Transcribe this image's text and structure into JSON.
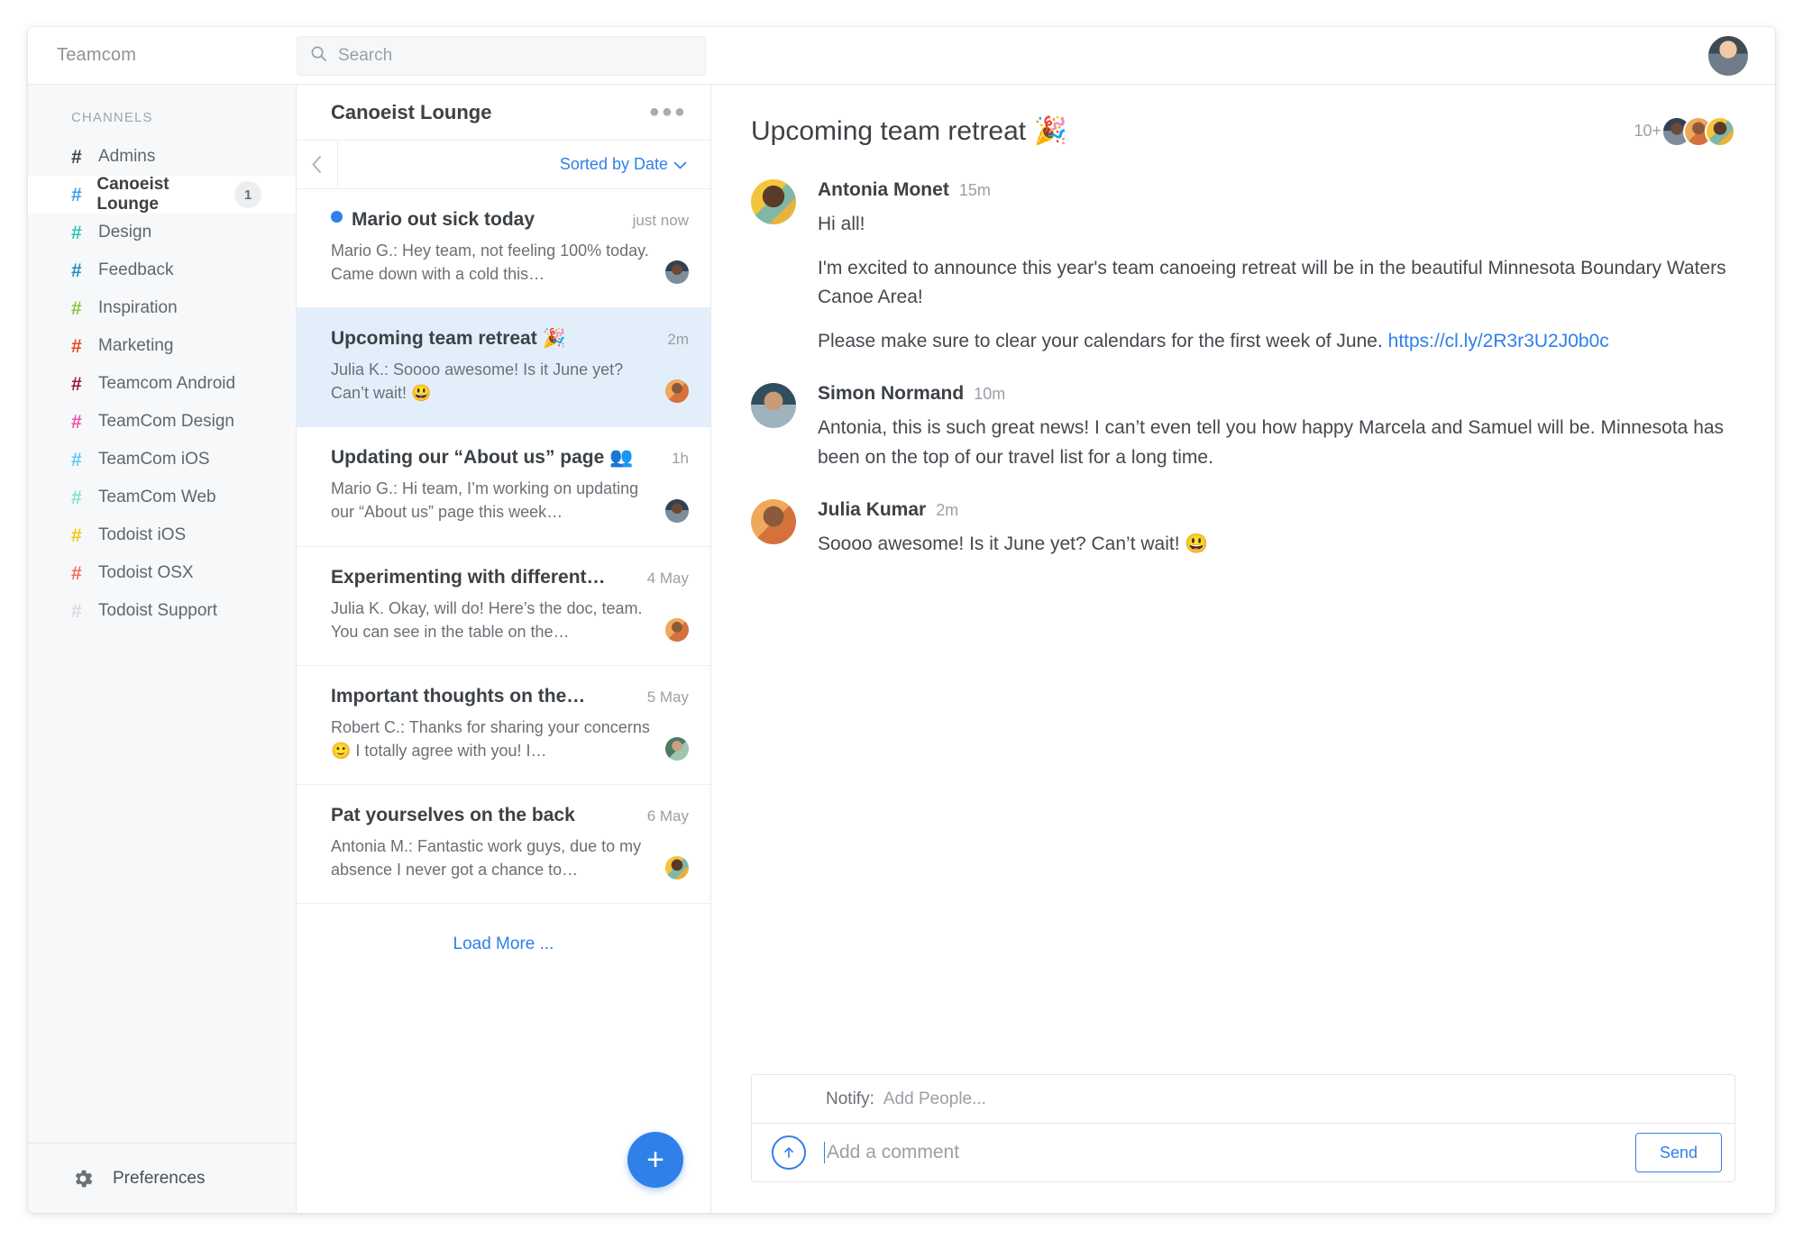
{
  "topbar": {
    "brand": "Teamcom",
    "search_placeholder": "Search",
    "search_value": ""
  },
  "sidebar": {
    "section_title": "CHANNELS",
    "channels": [
      {
        "label": "Admins",
        "color": "#3c4146",
        "badge": "",
        "active": false
      },
      {
        "label": "Canoeist Lounge",
        "color": "#3ba3f0",
        "badge": "1",
        "active": true
      },
      {
        "label": "Design",
        "color": "#2ec4b6",
        "badge": "",
        "active": false
      },
      {
        "label": "Feedback",
        "color": "#1f8fbf",
        "badge": "",
        "active": false
      },
      {
        "label": "Inspiration",
        "color": "#8cc63f",
        "badge": "",
        "active": false
      },
      {
        "label": "Marketing",
        "color": "#e8491f",
        "badge": "",
        "active": false
      },
      {
        "label": "Teamcom Android",
        "color": "#9c1439",
        "badge": "",
        "active": false
      },
      {
        "label": "TeamCom Design",
        "color": "#ef52a8",
        "badge": "",
        "active": false
      },
      {
        "label": "TeamCom iOS",
        "color": "#5ecbf7",
        "badge": "",
        "active": false
      },
      {
        "label": "TeamCom Web",
        "color": "#7fe3c8",
        "badge": "",
        "active": false
      },
      {
        "label": "Todoist iOS",
        "color": "#f5c518",
        "badge": "",
        "active": false
      },
      {
        "label": "Todoist OSX",
        "color": "#f07057",
        "badge": "",
        "active": false
      },
      {
        "label": "Todoist Support",
        "color": "#d8dade",
        "badge": "",
        "active": false
      }
    ],
    "preferences_label": "Preferences"
  },
  "threads_panel": {
    "title": "Canoeist Lounge",
    "sort_label": "Sorted by Date",
    "load_more_label": "Load More ...",
    "new_thread_label": "+",
    "items": [
      {
        "title": "Mario out sick today",
        "time": "just now",
        "preview": "Mario G.: Hey team, not feeling 100% today. Came down with a cold this…",
        "unread": true,
        "selected": false,
        "avatar": "mario"
      },
      {
        "title": "Upcoming team retreat 🎉",
        "time": "2m",
        "preview": "Julia K.: Soooo awesome! Is it June yet? Can’t wait! 😃",
        "unread": false,
        "selected": true,
        "avatar": "julia"
      },
      {
        "title": "Updating our “About us” page 👥",
        "time": "1h",
        "preview": "Mario G.: Hi team, I’m working on updating our “About us” page this week…",
        "unread": false,
        "selected": false,
        "avatar": "mario"
      },
      {
        "title": "Experimenting with different…",
        "time": "4 May",
        "preview": "Julia K. Okay, will do! Here’s the doc, team. You can see in the table on the…",
        "unread": false,
        "selected": false,
        "avatar": "julia"
      },
      {
        "title": "Important thoughts on the…",
        "time": "5 May",
        "preview": "Robert C.: Thanks for sharing your concerns 🙂 I totally agree with you! I…",
        "unread": false,
        "selected": false,
        "avatar": "robert"
      },
      {
        "title": "Pat yourselves on the back",
        "time": "6 May",
        "preview": "Antonia M.: Fantastic work guys, due to my absence I never got a chance to…",
        "unread": false,
        "selected": false,
        "avatar": "antonia"
      }
    ]
  },
  "conversation": {
    "title": "Upcoming team retreat 🎉",
    "participants_count": "10+",
    "messages": [
      {
        "name": "Antonia Monet",
        "time": "15m",
        "avatar": "antonia",
        "paragraphs": [
          "Hi all!",
          "I'm excited to announce this year's team canoeing retreat will be in the beautiful Minnesota Boundary Waters Canoe Area!"
        ],
        "trailing_text": "Please make sure to clear your calendars for the first week of June. ",
        "link": "https://cl.ly/2R3r3U2J0b0c"
      },
      {
        "name": "Simon Normand",
        "time": "10m",
        "avatar": "simon",
        "paragraphs": [
          "Antonia, this is such great news! I can’t even tell you how happy Marcela and Samuel will be. Minnesota has been on the top of our travel list for a long time."
        ],
        "trailing_text": "",
        "link": ""
      },
      {
        "name": "Julia Kumar",
        "time": "2m",
        "avatar": "julia",
        "paragraphs": [
          "Soooo awesome! Is it June yet? Can’t wait! 😃"
        ],
        "trailing_text": "",
        "link": ""
      }
    ]
  },
  "composer": {
    "notify_label": "Notify:",
    "notify_placeholder": "Add People...",
    "comment_placeholder": "Add a comment",
    "send_label": "Send"
  },
  "colors": {
    "accent": "#2f80e8",
    "selected_row": "#e2effb",
    "sidebar_bg": "#f7f8f9"
  }
}
